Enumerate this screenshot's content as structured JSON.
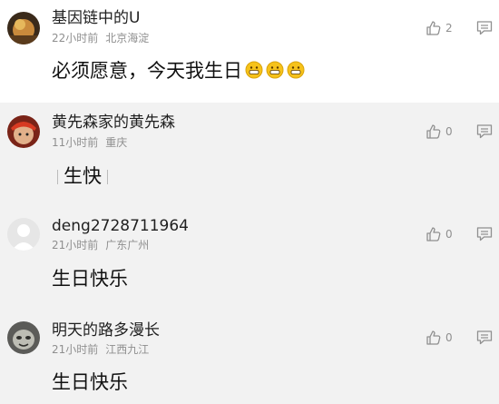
{
  "comments": [
    {
      "user": "基因链中的U",
      "time": "22小时前",
      "location": "北京海淀",
      "text": "必须愿意，今天我生日",
      "likes": "2",
      "emoji": "grinning-face-emoji"
    },
    {
      "user": "黄先森家的黄先森",
      "time": "11小时前",
      "location": "重庆",
      "text": "生快",
      "likes": "0"
    },
    {
      "user": "deng2728711964",
      "time": "21小时前",
      "location": "广东广州",
      "text": "生日快乐",
      "likes": "0"
    },
    {
      "user": "明天的路多漫长",
      "time": "21小时前",
      "location": "江西九江",
      "text": "生日快乐",
      "likes": "0"
    }
  ],
  "colors": {
    "page_bg": "#f2f2f2",
    "first_bg": "#ffffff",
    "meta": "#8f8f8f",
    "emoji": "#f6c21a"
  },
  "icons": {
    "like": "thumbs-up-icon",
    "reply": "comment-bubble-icon"
  }
}
